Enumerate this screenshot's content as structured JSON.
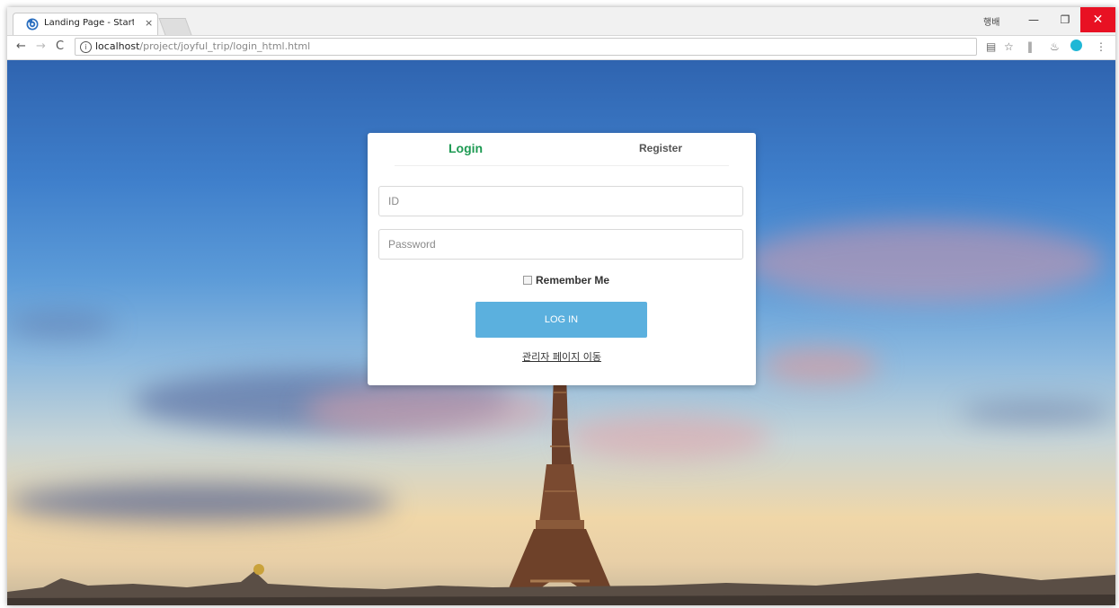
{
  "browser": {
    "tab": {
      "title": "Landing Page - Start Bo",
      "close_glyph": "×"
    },
    "profile_badge": "행배",
    "window_controls": {
      "minimize": "—",
      "restore": "❐",
      "close": "✕"
    },
    "nav": {
      "back": "←",
      "forward": "→",
      "reload": "C"
    },
    "address": {
      "host": "localhost",
      "path": "/project/joyful_trip/login_html.html"
    },
    "icons": [
      "info-icon",
      "translate-icon",
      "star-icon",
      "extension-icon",
      "incognito-icon",
      "grammarly-icon",
      "menu-icon"
    ],
    "toolbar_glyphs": {
      "translate": "▤",
      "star": "☆",
      "ext_a": "‖",
      "ext_b": "♨",
      "menu": "⋮"
    }
  },
  "login_card": {
    "tabs": [
      {
        "label": "Login",
        "active": true
      },
      {
        "label": "Register",
        "active": false
      }
    ],
    "id_field": {
      "placeholder": "ID",
      "value": ""
    },
    "password_field": {
      "placeholder": "Password",
      "value": ""
    },
    "remember_label": "Remember Me",
    "remember_checked": false,
    "submit_label": "LOG IN",
    "admin_link": "관리자 페이지 이동"
  },
  "colors": {
    "active_tab": "#1e9a53",
    "button": "#5bb0de",
    "close_button": "#e81123"
  }
}
